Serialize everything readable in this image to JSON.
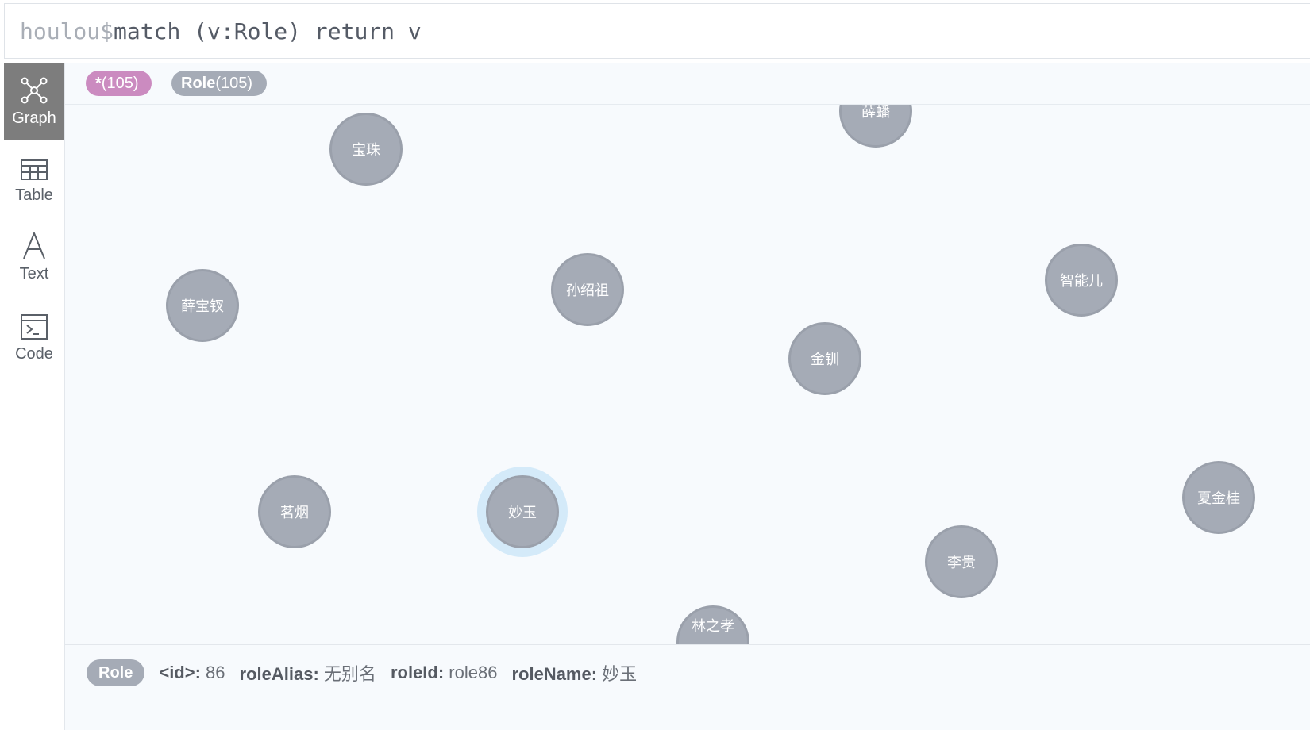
{
  "query": {
    "prompt": "houlou$",
    "text": "match (v:Role) return v"
  },
  "nav": {
    "items": [
      {
        "key": "graph",
        "label": "Graph",
        "active": true
      },
      {
        "key": "table",
        "label": "Table",
        "active": false
      },
      {
        "key": "text",
        "label": "Text",
        "active": false
      },
      {
        "key": "code",
        "label": "Code",
        "active": false
      }
    ]
  },
  "labels": {
    "all": {
      "name": "*",
      "count": "(105)",
      "color": "#cb8bc0"
    },
    "role": {
      "name": "Role",
      "count": "(105)",
      "color": "#a5abb6"
    }
  },
  "nodes": [
    {
      "name": "宝珠"
    },
    {
      "name": "薛蟠"
    },
    {
      "name": "薛宝钗"
    },
    {
      "name": "孙绍祖"
    },
    {
      "name": "智能儿"
    },
    {
      "name": "金钏"
    },
    {
      "name": "茗烟"
    },
    {
      "name": "妙玉",
      "selected": true
    },
    {
      "name": "夏金桂"
    },
    {
      "name": "李贵"
    },
    {
      "name": "林之孝"
    }
  ],
  "inspector": {
    "label": "Role",
    "label_color": "#a5abb6",
    "properties": [
      {
        "key": "<id>:",
        "value": "86"
      },
      {
        "key": "roleAlias:",
        "value": "无别名"
      },
      {
        "key": "roleId:",
        "value": "role86"
      },
      {
        "key": "roleName:",
        "value": "妙玉"
      }
    ]
  }
}
